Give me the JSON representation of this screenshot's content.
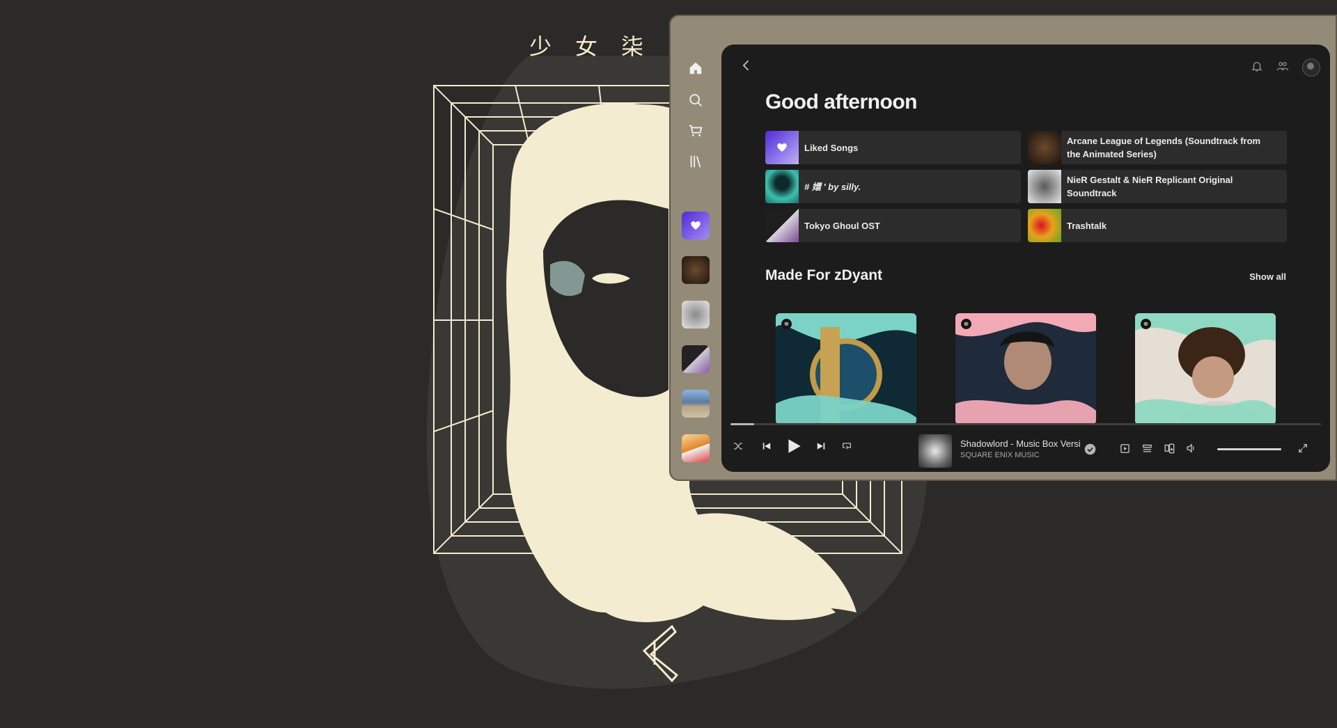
{
  "wallpaper": {
    "title": "少女柒"
  },
  "sidebar": {
    "nav": [
      {
        "name": "home-icon"
      },
      {
        "name": "search-icon"
      },
      {
        "name": "cart-icon"
      },
      {
        "name": "library-icon"
      }
    ],
    "pinned": [
      {
        "name": "pinned-liked-songs",
        "color": "#7e5bef"
      },
      {
        "name": "pinned-arcane",
        "color": "#3a2a1e"
      },
      {
        "name": "pinned-nier",
        "color": "#c9c9c9"
      },
      {
        "name": "pinned-tokyo-ghoul",
        "color": "#4a3b55"
      },
      {
        "name": "pinned-landscape",
        "color": "#6f8fb0"
      },
      {
        "name": "pinned-forza",
        "color": "#d9a33b"
      }
    ]
  },
  "header": {
    "greeting": "Good afternoon",
    "icons": [
      "bell-icon",
      "friends-icon",
      "avatar"
    ]
  },
  "quick_picks": [
    {
      "label": "Liked Songs",
      "art_color": "#6b4cf0"
    },
    {
      "label": "Arcane League of Legends (Soundtrack from the Animated Series)",
      "art_color": "#2b2119"
    },
    {
      "label": "# 嬛 ' by silly. ",
      "art_color": "#2aa8a0"
    },
    {
      "label": "NieR Gestalt & NieR Replicant Original Soundtrack",
      "art_color": "#d8d8d8"
    },
    {
      "label": "Tokyo Ghoul OST",
      "art_color": "#3c3c3c"
    },
    {
      "label": "Trashtalk",
      "art_color": "#e8a21a"
    }
  ],
  "made_for": {
    "title": "Made For zDyant",
    "show_all": "Show all",
    "cards": [
      {
        "name": "daily-mix-1",
        "bg": "#7ad3c6",
        "accent": "#1d3c4a"
      },
      {
        "name": "daily-mix-2",
        "bg": "#f2a9b6",
        "accent": "#1f2a3a"
      },
      {
        "name": "daily-mix-3",
        "bg": "#8fd9c2",
        "accent": "#e4ded4"
      }
    ]
  },
  "player": {
    "track_title": "Shadowlord - Music Box Version",
    "artist": "SQUARE ENIX MUSIC",
    "progress": 0.04,
    "volume": 1.0
  },
  "colors": {
    "window_frame": "#938b78",
    "panel": "#1c1c1c",
    "tile": "#2c2c2c",
    "wallpaper": "#2b2a28",
    "cream": "#f4ecd0"
  }
}
